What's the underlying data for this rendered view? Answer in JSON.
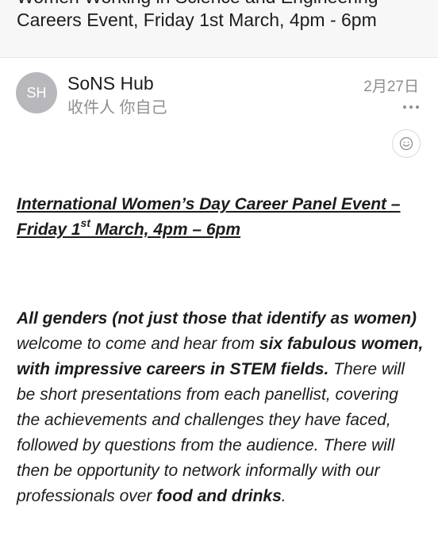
{
  "subject": {
    "line1": "Women Working in Science and Engineering",
    "line2": "Careers Event, Friday 1st March, 4pm - 6pm"
  },
  "sender": {
    "initials": "SH",
    "name": "SoNS Hub",
    "recipient": "收件人 你自己",
    "date": "2月27日"
  },
  "icons": {
    "more": "more-icon",
    "emoji": "emoji-reaction-icon"
  },
  "colors": {
    "avatar": "#b8b8bc",
    "secondary_text": "#8e8e93"
  },
  "body": {
    "heading_part1": "International Women’s Day Career Panel Event – Friday 1",
    "heading_sup": "st",
    "heading_part2": " March, 4pm – 6pm",
    "p_bold1": "All genders (not just those that identify as women)",
    "p_text1": " welcome to come and hear from ",
    "p_bold2": "six fabulous women, with impressive careers in STEM fields.",
    "p_text2": " There will be short presentations from each panellist, covering the achievements and challenges they have faced, followed by questions from the audience. There will then be opportunity to network informally with our professionals over ",
    "p_bold3": "food and drinks",
    "p_text3": "."
  }
}
